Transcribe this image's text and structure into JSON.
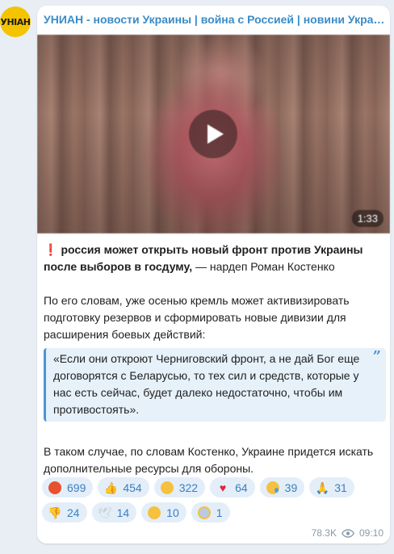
{
  "channel": {
    "name": "УНИАН - новости Украины | война с Россией | новини Україні..."
  },
  "avatar": {
    "label": "УНІАН"
  },
  "video": {
    "duration": "1:33"
  },
  "post": {
    "headline_bold": "россия может открыть новый фронт против Украины после выборов в госдуму,",
    "headline_rest": " — нардеп Роман Костенко",
    "paragraph1": "По его словам, уже осенью кремль может активизировать подготовку резервов и сформировать новые дивизии для расширения боевых действий:",
    "quote": "«Если они откроют Черниговский фронт, а не дай Бог еще договорятся с Беларусью, то тех сил и средств, которые у нас есть сейчас, будет далеко недостаточно, чтобы им противостоять».",
    "paragraph2": "В таком случае, по словам Костенко, Украине придется искать дополнительные ресурсы для обороны."
  },
  "reactions": [
    {
      "icon": "angry-face-icon",
      "count": "699"
    },
    {
      "icon": "thumbs-up-icon",
      "count": "454"
    },
    {
      "icon": "grinning-face-icon",
      "count": "322"
    },
    {
      "icon": "heart-icon",
      "count": "64"
    },
    {
      "icon": "crying-face-icon",
      "count": "39"
    },
    {
      "icon": "praying-hands-icon",
      "count": "31"
    },
    {
      "icon": "thumbs-down-icon",
      "count": "24"
    },
    {
      "icon": "dove-icon",
      "count": "14"
    },
    {
      "icon": "neutral-face-icon",
      "count": "10"
    },
    {
      "icon": "screaming-face-icon",
      "count": "1"
    }
  ],
  "footer": {
    "views": "78.3K",
    "time": "09:10"
  },
  "colors": {
    "accent": "#3a8cc8",
    "quote_border": "#4a95d6",
    "reaction_bg": "#e3eef9",
    "avatar_bg": "#f5c400"
  }
}
